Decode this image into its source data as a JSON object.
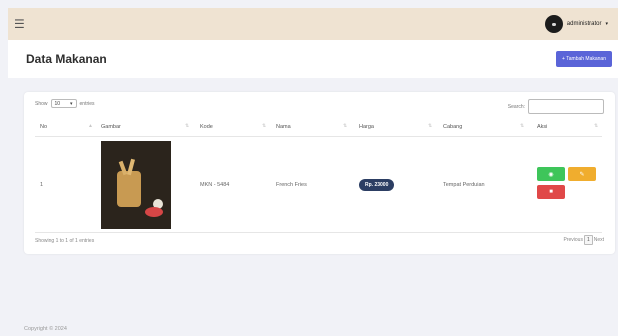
{
  "topbar": {
    "menu_icon": "hamburger-icon",
    "username": "administrator",
    "caret": "▾"
  },
  "header": {
    "title": "Data Makanan",
    "add_button_label": "+ Tambah Makanan"
  },
  "table": {
    "show_label": "Show",
    "entries_value": "10",
    "entries_label": "entries",
    "search_label": "Search:",
    "search_value": "",
    "columns": [
      "No",
      "Gambar",
      "Kode",
      "Nama",
      "Harga",
      "Cabang",
      "Aksi"
    ],
    "rows": [
      {
        "no": "1",
        "kode": "MKN - 5484",
        "nama": "French Fries",
        "harga": "Rp. 23000",
        "cabang": "Tempat Perduian"
      }
    ],
    "info": "Showing 1 to 1 of 1 entries",
    "pagination": {
      "previous": "Previous",
      "page": "1",
      "next": "Next"
    }
  },
  "footer": {
    "copyright": "Copyright © 2024"
  },
  "colors": {
    "primary": "#5a64d8",
    "success": "#3ec55a",
    "warning": "#f0ad2e",
    "danger": "#e04848",
    "price_badge": "#2c3e63",
    "topbar": "#efe3d2"
  }
}
